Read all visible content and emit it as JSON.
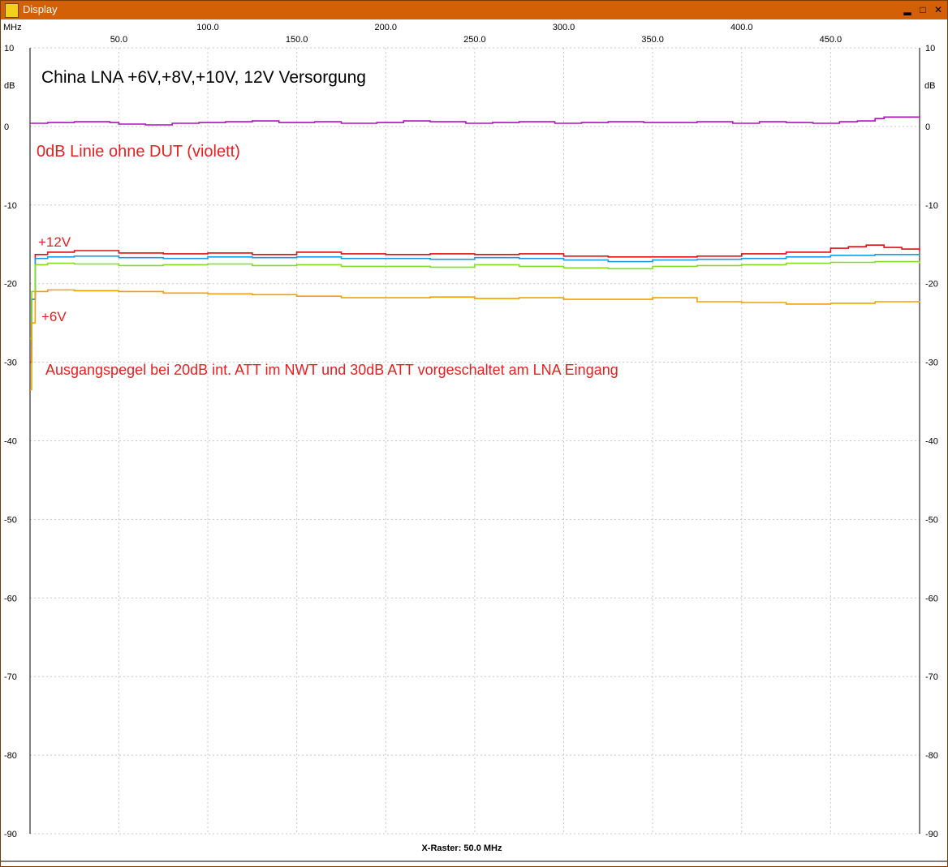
{
  "window": {
    "title": "Display",
    "minimize_symbol": "▂",
    "maximize_symbol": "□",
    "close_symbol": "✕"
  },
  "colors": {
    "titlebar": "#d35f06",
    "grid": "#c8c8c8",
    "annotation_red": "#e82020",
    "violet": "#b010c0",
    "red": "#e01010",
    "blue": "#1a9be8",
    "green": "#80e020",
    "orange": "#f5a000"
  },
  "chart_data": {
    "type": "line",
    "x_unit": "MHz",
    "y_unit": "dB",
    "xlim": [
      0.1,
      500
    ],
    "ylim": [
      -90,
      10
    ],
    "grid": true,
    "x_ticks_upper": [
      "100.0",
      "200.0",
      "300.0",
      "400.0"
    ],
    "x_ticks_lower": [
      "50.0",
      "150.0",
      "250.0",
      "350.0",
      "450.0"
    ],
    "x_tick_values_upper": [
      100,
      200,
      300,
      400
    ],
    "x_tick_values_lower": [
      50,
      150,
      250,
      350,
      450
    ],
    "y_ticks": [
      10,
      0,
      -10,
      -20,
      -30,
      -40,
      -50,
      -60,
      -70,
      -80,
      -90
    ],
    "y_tick_labels": [
      "10",
      "0",
      "-10",
      "-20",
      "-30",
      "-40",
      "-50",
      "-60",
      "-70",
      "-80",
      "-90"
    ],
    "footer": "X-Raster: 50.0 MHz",
    "annotations": {
      "title": "China LNA +6V,+8V,+10V, 12V Versorgung",
      "zero_line_note": "0dB Linie ohne DUT (violett)",
      "label_12v": "+12V",
      "label_6v": "+6V",
      "output_note": "Ausgangspegel bei 20dB int. ATT im NWT und 30dB ATT vorgeschaltet am LNA Eingang"
    },
    "series": [
      {
        "color": "#b010c0",
        "x": [
          0.1,
          10,
          25,
          45,
          50,
          65,
          80,
          95,
          110,
          125,
          140,
          160,
          175,
          195,
          210,
          225,
          245,
          260,
          275,
          295,
          310,
          325,
          345,
          360,
          375,
          395,
          410,
          425,
          440,
          455,
          465,
          475,
          480,
          490,
          500
        ],
        "y": [
          0.4,
          0.5,
          0.6,
          0.5,
          0.3,
          0.2,
          0.4,
          0.5,
          0.6,
          0.7,
          0.5,
          0.6,
          0.4,
          0.5,
          0.7,
          0.6,
          0.4,
          0.5,
          0.6,
          0.4,
          0.5,
          0.6,
          0.5,
          0.5,
          0.6,
          0.4,
          0.6,
          0.5,
          0.4,
          0.6,
          0.7,
          1.0,
          1.2,
          1.2,
          1.1
        ]
      },
      {
        "color": "#e01010",
        "x": [
          0.1,
          1,
          3,
          10,
          25,
          50,
          75,
          100,
          125,
          150,
          175,
          200,
          225,
          250,
          275,
          300,
          325,
          350,
          375,
          400,
          425,
          450,
          460,
          470,
          480,
          490,
          500
        ],
        "y": [
          -30,
          -22,
          -16.3,
          -16,
          -15.8,
          -16.1,
          -16.2,
          -16.1,
          -16.3,
          -16.0,
          -16.2,
          -16.3,
          -16.2,
          -16.3,
          -16.2,
          -16.5,
          -16.6,
          -16.6,
          -16.5,
          -16.2,
          -16.0,
          -15.5,
          -15.3,
          -15.1,
          -15.4,
          -15.6,
          -15.8
        ]
      },
      {
        "color": "#1a9be8",
        "x": [
          0.1,
          1,
          3,
          10,
          25,
          50,
          75,
          100,
          125,
          150,
          175,
          200,
          225,
          250,
          275,
          300,
          325,
          350,
          375,
          400,
          425,
          450,
          475,
          500
        ],
        "y": [
          -28,
          -22,
          -16.8,
          -16.6,
          -16.5,
          -16.7,
          -16.8,
          -16.6,
          -16.7,
          -16.6,
          -16.8,
          -16.8,
          -16.9,
          -16.7,
          -16.8,
          -17.0,
          -17.2,
          -17.0,
          -16.9,
          -16.8,
          -16.6,
          -16.4,
          -16.3,
          -16.4
        ]
      },
      {
        "color": "#80e020",
        "x": [
          0.1,
          1,
          3,
          10,
          25,
          50,
          75,
          100,
          125,
          150,
          175,
          200,
          225,
          250,
          275,
          300,
          325,
          350,
          375,
          400,
          425,
          450,
          475,
          500
        ],
        "y": [
          -27,
          -21,
          -17.6,
          -17.4,
          -17.5,
          -17.7,
          -17.6,
          -17.5,
          -17.7,
          -17.6,
          -17.8,
          -17.8,
          -17.9,
          -17.6,
          -17.8,
          -18.0,
          -18.1,
          -17.8,
          -17.7,
          -17.6,
          -17.4,
          -17.3,
          -17.2,
          -17.4
        ]
      },
      {
        "color": "#f5a000",
        "x": [
          0.1,
          1,
          3,
          10,
          25,
          50,
          75,
          100,
          125,
          150,
          175,
          200,
          225,
          250,
          275,
          300,
          325,
          350,
          375,
          400,
          425,
          450,
          475,
          500
        ],
        "y": [
          -33.5,
          -25,
          -21.0,
          -20.8,
          -20.9,
          -21.0,
          -21.2,
          -21.3,
          -21.4,
          -21.6,
          -21.8,
          -21.8,
          -21.7,
          -21.9,
          -21.8,
          -22.0,
          -22.0,
          -21.8,
          -22.3,
          -22.4,
          -22.6,
          -22.5,
          -22.3,
          -22.4
        ]
      }
    ]
  }
}
